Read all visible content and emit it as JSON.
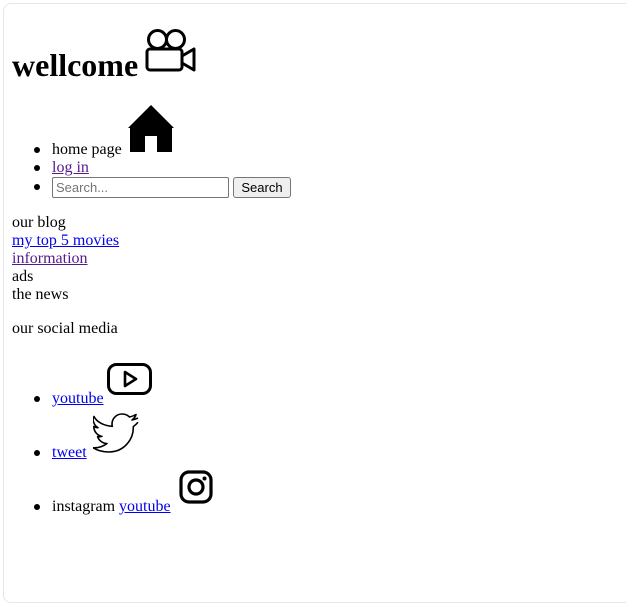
{
  "header": {
    "title": "wellcome",
    "title_icon": "video-camera-icon"
  },
  "nav": {
    "home_label": "home page",
    "home_icon": "home-icon",
    "login_label": "log in",
    "search_placeholder": "Search...",
    "search_value": "",
    "search_button_label": "Search"
  },
  "menu": {
    "blog_label": "our blog",
    "movies_link": "my top 5 movies",
    "information_link": "information",
    "ads_label": "ads",
    "news_label": "the news"
  },
  "social": {
    "heading": "our social media",
    "youtube_link": "youtube",
    "youtube_icon": "youtube-icon",
    "tweet_link": "tweet",
    "twitter_icon": "twitter-bird-icon",
    "instagram_label": "instagram",
    "instagram_link": "youtube",
    "instagram_icon": "instagram-icon"
  },
  "colors": {
    "link": "#0000ee",
    "visited_link": "#551a8b",
    "text": "#000000"
  }
}
